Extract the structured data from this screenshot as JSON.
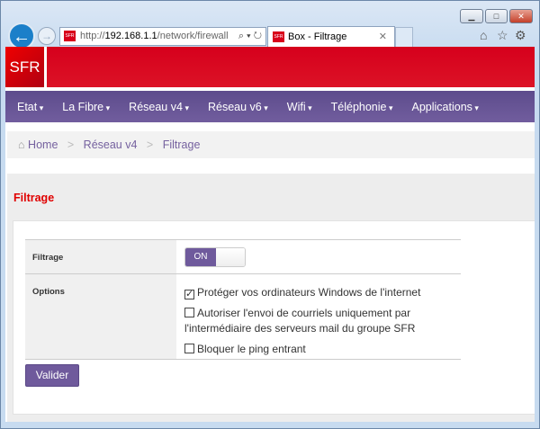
{
  "browser": {
    "url_prefix": "http://",
    "url_host": "192.168.1.1",
    "url_path": "/network/firewall",
    "tab_title": "Box - Filtrage",
    "favicon_text": "SFR"
  },
  "header": {
    "logo": "SFR"
  },
  "nav": {
    "items": [
      "Etat",
      "La Fibre",
      "Réseau v4",
      "Réseau v6",
      "Wifi",
      "Téléphonie",
      "Applications"
    ]
  },
  "breadcrumb": {
    "home": "Home",
    "items": [
      "Réseau v4",
      "Filtrage"
    ],
    "separator": ">"
  },
  "page": {
    "title": "Filtrage"
  },
  "form": {
    "filtrage_label": "Filtrage",
    "toggle_label": "ON",
    "toggle_on": true,
    "options_label": "Options",
    "options": [
      {
        "label": "Protéger vos ordinateurs Windows de l'internet",
        "checked": true
      },
      {
        "label": "Autoriser l'envoi de courriels uniquement par l'intermédiaire des serveurs mail du groupe SFR",
        "checked": false
      },
      {
        "label": "Bloquer le ping entrant",
        "checked": false
      }
    ],
    "submit": "Valider"
  },
  "colors": {
    "brand_red": "#d8001a",
    "accent_purple": "#6f5a9c"
  }
}
